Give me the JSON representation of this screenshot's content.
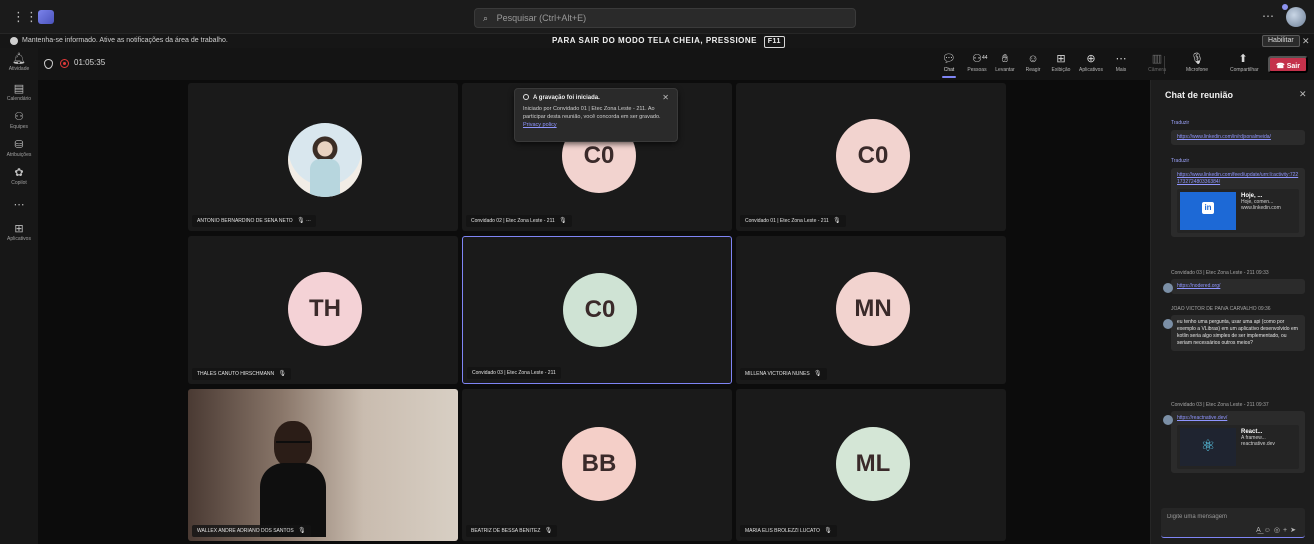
{
  "topbar": {
    "search_placeholder": "Pesquisar (Ctrl+Alt+E)"
  },
  "banner": {
    "text": "Mantenha-se informado. Ative as notificações da área de trabalho.",
    "fullscreen_msg": "PARA SAIR DO MODO TELA CHEIA, PRESSIONE",
    "fullscreen_key": "F11",
    "enable_label": "Habilitar"
  },
  "rail": {
    "items": [
      {
        "label": "Atividade",
        "icon": "bell-icon"
      },
      {
        "label": "Calendário",
        "icon": "calendar-icon"
      },
      {
        "label": "Equipes",
        "icon": "teams-icon"
      },
      {
        "label": "Atribuições",
        "icon": "assignments-icon"
      },
      {
        "label": "Copilot",
        "icon": "copilot-icon"
      },
      {
        "label": "Aplicativos",
        "icon": "apps-icon"
      }
    ]
  },
  "meeting": {
    "timer": "01:05:35",
    "toolbar": {
      "chat": "Chat",
      "people": "Pessoas",
      "people_count": "44",
      "raise": "Levantar",
      "react": "Reagir",
      "view": "Exibição",
      "apps": "Aplicativos",
      "more": "Mais",
      "camera": "Câmera",
      "mic": "Microfone",
      "share": "Compartilhar",
      "leave": "Sair"
    }
  },
  "toast": {
    "title": "A gravação foi iniciada.",
    "body": "Iniciado por Convidado 01 | Etec Zona Leste - 211. Ao participar desta reunião, você concorda em ser gravado.",
    "link": "Privacy policy"
  },
  "participants": [
    {
      "name": "ANTONIO BERNARDINO DE SENA NETO",
      "initials": "",
      "type": "photo"
    },
    {
      "name": "Convidado 02 | Etec Zona Leste - 211",
      "initials": "C0",
      "color": "#f2d3cf"
    },
    {
      "name": "Convidado 01 | Etec Zona Leste - 211",
      "initials": "C0",
      "color": "#f2d3cf"
    },
    {
      "name": "THALES CANUTO HIRSCHMANN",
      "initials": "TH",
      "color": "#f4d2d6"
    },
    {
      "name": "Convidado 03 | Etec Zona Leste - 211",
      "initials": "C0",
      "color": "#cfe3d4"
    },
    {
      "name": "MILLENA VICTORIA NUNES",
      "initials": "MN",
      "color": "#f2d3cf"
    },
    {
      "name": "WALLEX ANDRE ADRIANO DOS SANTOS",
      "initials": "",
      "type": "camera"
    },
    {
      "name": "BEATRIZ DE BESSA BENITEZ",
      "initials": "BB",
      "color": "#f4cfc8"
    },
    {
      "name": "MARIA ELIS BROLEZZI LUCATO",
      "initials": "ML",
      "color": "#d4e6d6"
    }
  ],
  "chat": {
    "title": "Chat de reunião",
    "translate_label": "Traduzir",
    "messages": [
      {
        "link": "https://www.linkedin.com/in/rdjsonalmeida/"
      },
      {
        "link": "https://www.linkedin.com/feed/update/urn:li:activity:722173272480336384/",
        "preview_title": "Hoje, ...",
        "preview_text": "Hoje, comen...",
        "preview_domain": "www.linkedin.com"
      },
      {
        "sender": "Convidado 03 | Etec Zona Leste - 211",
        "time": "09:33",
        "link": "https://nodered.org/"
      },
      {
        "sender": "JOAO VICTOR DE PAIVA CARVALHO",
        "time": "09:36",
        "text": "eu tenho uma pergunta, usar uma api (como por exemplo a VLibras) em um aplicativo desenvolvido em kotlin seria algo simples de ser implementado, ou seriam necessários outros meios?"
      },
      {
        "sender": "Convidado 03 | Etec Zona Leste - 211",
        "time": "09:37",
        "link": "https://reactnative.dev/",
        "preview_title": "React...",
        "preview_text": "A framew...",
        "preview_domain": "reactnative.dev"
      }
    ],
    "compose_placeholder": "Digite uma mensagem"
  }
}
